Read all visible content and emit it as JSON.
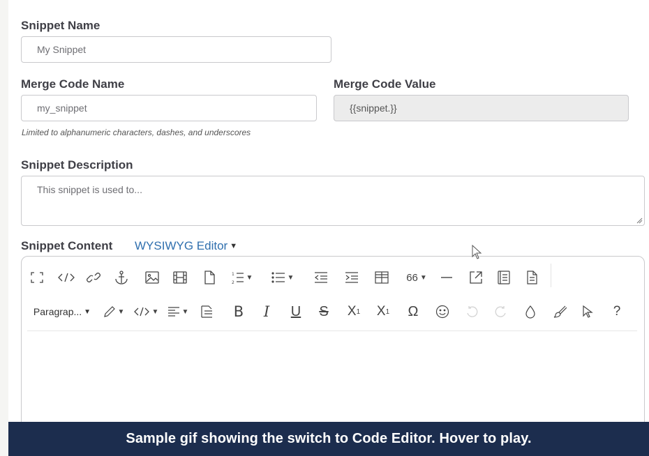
{
  "snippet_name": {
    "label": "Snippet Name",
    "value": "My Snippet"
  },
  "merge_code_name": {
    "label": "Merge Code Name",
    "value": "my_snippet",
    "hint": "Limited to alphanumeric characters, dashes, and underscores"
  },
  "merge_code_value": {
    "label": "Merge Code Value",
    "value": "{{snippet.}}"
  },
  "snippet_description": {
    "label": "Snippet Description",
    "placeholder": "This snippet is used to..."
  },
  "snippet_content": {
    "label": "Snippet Content",
    "editor_mode": "WYSIWYG Editor"
  },
  "toolbar": {
    "row1": [
      "fullscreen-icon",
      "source-code-icon",
      "link-icon",
      "anchor-icon",
      "image-icon",
      "media-icon",
      "page-icon",
      "numbered-list-icon",
      "bullet-list-icon",
      "outdent-icon",
      "indent-icon",
      "table-icon",
      "blockquote-icon",
      "horizontal-rule-icon",
      "external-link-icon",
      "template-icon",
      "document-icon"
    ],
    "blockquote_glyph": "66",
    "paragraph_label": "Paragrap...",
    "help_glyph": "?"
  },
  "banner": {
    "text": "Sample gif showing the switch to Code Editor. Hover to play."
  },
  "colors": {
    "accent": "#2f6fae",
    "banner_bg": "#1c2d4e",
    "border": "#c9c9cc"
  }
}
